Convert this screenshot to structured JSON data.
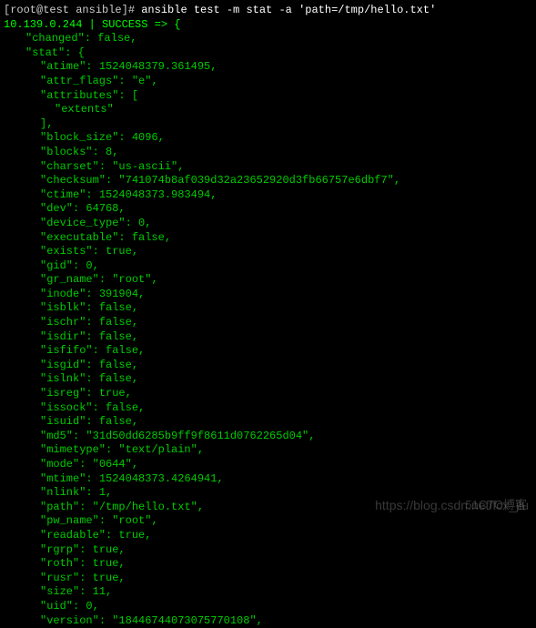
{
  "prompt": {
    "user_host": "[root@test ansible]# ",
    "command": "ansible test -m stat -a 'path=/tmp/hello.txt'"
  },
  "result_header": "10.139.0.244 | SUCCESS => {",
  "stat": {
    "changed": "false",
    "stat_open": "{",
    "atime": "1524048379.361495",
    "attr_flags": "\"e\"",
    "attributes_open": "[",
    "attributes_item": "\"extents\"",
    "attributes_close": "],",
    "block_size": "4096",
    "blocks": "8",
    "charset": "\"us-ascii\"",
    "checksum": "\"741074b8af039d32a23652920d3fb66757e6dbf7\"",
    "ctime": "1524048373.983494",
    "dev": "64768",
    "device_type": "0",
    "executable": "false",
    "exists": "true",
    "gid": "0",
    "gr_name": "\"root\"",
    "inode": "391904",
    "isblk": "false",
    "ischr": "false",
    "isdir": "false",
    "isfifo": "false",
    "isgid": "false",
    "islnk": "false",
    "isreg": "true",
    "issock": "false",
    "isuid": "false",
    "md5": "\"31d50dd6285b9ff9f8611d0762265d04\"",
    "mimetype": "\"text/plain\"",
    "mode": "\"0644\"",
    "mtime": "1524048373.4264941",
    "nlink": "1",
    "path": "\"/tmp/hello.txt\"",
    "pw_name": "\"root\"",
    "readable": "true",
    "rgrp": "true",
    "roth": "true",
    "rusr": "true",
    "size": "11",
    "uid": "0",
    "version": "\"18446744073075770108\""
  },
  "watermark": "https://blog.csdn.net/fcx_jlu",
  "watermark2": "51CTO博客"
}
